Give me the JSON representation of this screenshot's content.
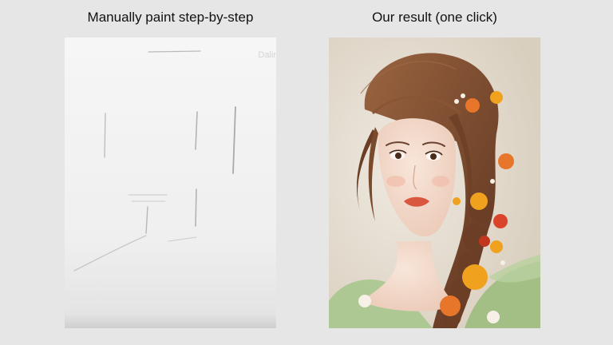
{
  "captions": {
    "left": "Manually paint step-by-step",
    "right": "Our result (one click)"
  },
  "left_panel": {
    "watermark": "Dalir"
  },
  "colors": {
    "page_background": "#e6e6e6",
    "canvas_background": "#f4f4f4",
    "sketch_stroke": "#8a8a8a",
    "hair": "#7a4a2c",
    "skin": "#f2d9c9",
    "lips": "#d9573f",
    "flower_orange": "#f0a21e",
    "flower_red": "#d9442a",
    "dress_green": "#a9c68e"
  }
}
